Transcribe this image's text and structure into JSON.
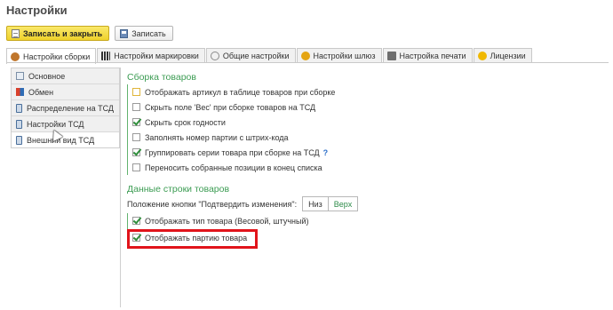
{
  "window": {
    "title": "Настройки"
  },
  "toolbar": {
    "save_close_label": "Записать и закрыть",
    "save_label": "Записать"
  },
  "tabs": [
    {
      "label": "Настройки сборки",
      "icon": "gear-icon",
      "color": "#c0762c",
      "active": true
    },
    {
      "label": "Настройки маркировки",
      "icon": "qr-code-icon",
      "color": "#333333"
    },
    {
      "label": "Общие настройки",
      "icon": "settings-icon",
      "color": "#8a8a8a"
    },
    {
      "label": "Настройки шлюз",
      "icon": "gateway-icon",
      "color": "#e4a412"
    },
    {
      "label": "Настройка печати",
      "icon": "printer-icon",
      "color": "#6e6e6e"
    },
    {
      "label": "Лицензии",
      "icon": "license-icon",
      "color": "#f0b800"
    }
  ],
  "sidebar": {
    "items": [
      {
        "label": "Основное",
        "icon": "document-icon",
        "color": "#7c8fa6"
      },
      {
        "label": "Обмен",
        "icon": "exchange-icon",
        "color": "#d9402b"
      },
      {
        "label": "Распределение на ТСД",
        "icon": "device-icon",
        "color": "#4a6f9b"
      },
      {
        "label": "Настройки ТСД",
        "icon": "device-icon",
        "color": "#4a6f9b"
      },
      {
        "label": "Внешний вид ТСД",
        "icon": "device-icon",
        "color": "#4a6f9b",
        "active": true
      }
    ]
  },
  "assembly": {
    "title": "Сборка товаров",
    "options": [
      {
        "label": "Отображать артикул в таблице товаров при сборке",
        "checked": false,
        "highlight": true
      },
      {
        "label": "Скрыть поле 'Вес' при сборке товаров на ТСД",
        "checked": false
      },
      {
        "label": "Скрыть срок годности",
        "checked": true
      },
      {
        "label": "Заполнять номер партии с штрих-кода",
        "checked": false
      },
      {
        "label": "Группировать серии товара при сборке на ТСД",
        "checked": true,
        "help": "?"
      },
      {
        "label": "Переносить собранные позиции в конец списка",
        "checked": false
      }
    ]
  },
  "row_data": {
    "title": "Данные строки товаров",
    "position_label": "Положение кнопки \"Подтвердить изменения\":",
    "position_options": [
      "Низ",
      "Верх"
    ],
    "position_selected": "Верх",
    "options": [
      {
        "label": "Отображать тип товара (Весовой, штучный)",
        "checked": true
      },
      {
        "label": "Отображать партию товара",
        "checked": true,
        "highlighted_frame_color": "#e1141b"
      }
    ]
  }
}
